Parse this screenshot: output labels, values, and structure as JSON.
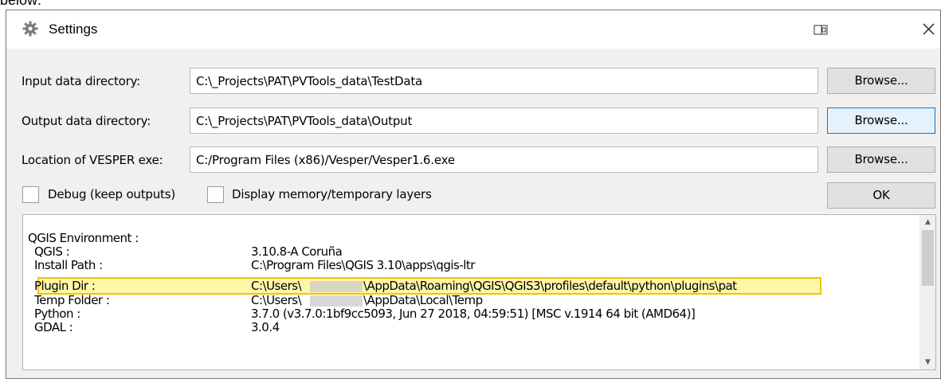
{
  "window": {
    "title": "Settings",
    "icons": {
      "title": "gear-icon",
      "restore": "restore-icon",
      "close": "close-icon"
    }
  },
  "above_text": "below:",
  "rows": [
    {
      "label": "Input data directory:",
      "value": "C:\\_Projects\\PAT\\PVTools_data\\TestData",
      "button": "Browse..."
    },
    {
      "label": "Output data directory:",
      "value": "C:\\_Projects\\PAT\\PVTools_data\\Output",
      "button": "Browse..."
    },
    {
      "label": "Location of VESPER exe:",
      "value": "C:/Program Files (x86)/Vesper/Vesper1.6.exe",
      "button": "Browse..."
    }
  ],
  "options": {
    "debug_label": "Debug (keep outputs)",
    "debug_checked": false,
    "memory_label": "Display memory/temporary layers",
    "memory_checked": false,
    "ok_label": "OK"
  },
  "environment": {
    "heading": "QGIS Environment :",
    "items": [
      {
        "key": "QGIS :",
        "value": "3.10.8-A Coruña"
      },
      {
        "key": "Install Path :",
        "value": "C:\\Program Files\\QGIS 3.10\\apps\\qgis-ltr"
      },
      {
        "key": "Plugin Dir :",
        "value_prefix": "C:\\Users\\",
        "value_suffix": "\\AppData\\Roaming\\QGIS\\QGIS3\\profiles\\default\\python\\plugins\\pat"
      },
      {
        "key": "Temp Folder :",
        "value_prefix": "C:\\Users\\",
        "value_suffix": "\\AppData\\Local\\Temp"
      },
      {
        "key": "Python :",
        "value": "3.7.0 (v3.7.0:1bf9cc5093, Jun 27 2018, 04:59:51) [MSC v.1914 64 bit (AMD64)]"
      },
      {
        "key": "GDAL :",
        "value": "3.0.4"
      }
    ],
    "highlight_color": "#f2c200"
  }
}
